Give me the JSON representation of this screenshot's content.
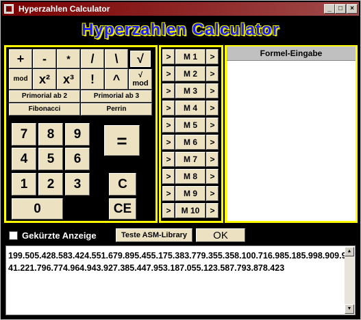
{
  "window": {
    "title": "Hyperzahlen Calculator",
    "minimize": "_",
    "maximize": "□",
    "close": "×"
  },
  "banner": {
    "title": "Hyperzahlen Calculator"
  },
  "ops": {
    "row1": [
      "+",
      "-",
      "*",
      "/",
      "\\",
      "√"
    ],
    "row2": [
      "mod",
      "x²",
      "x³",
      "!",
      "^",
      "√\nmod"
    ],
    "primorial2": "Primorial ab 2",
    "primorial3": "Primorial ab 3",
    "fibonacci": "Fibonacci",
    "perrin": "Perrin"
  },
  "keypad": {
    "keys": [
      "7",
      "8",
      "9",
      "4",
      "5",
      "6",
      "1",
      "2",
      "3",
      "0"
    ],
    "equals": "=",
    "clear": "C",
    "clear_entry": "CE"
  },
  "memory": {
    "arrow": ">",
    "labels": [
      "M 1",
      "M 2",
      "M 3",
      "M 4",
      "M 5",
      "M 6",
      "M 7",
      "M 8",
      "M 9",
      "M 10"
    ]
  },
  "formel": {
    "header": "Formel-Eingabe",
    "value": ""
  },
  "options": {
    "shortened_label": "Gekürzte Anzeige",
    "shortened_checked": false,
    "test_label": "Teste ASM-Library",
    "ok_label": "OK"
  },
  "output": {
    "text": "199.505.428.583.424.551.679.895.455.175.383.779.355.358.100.716.985.185.998.909.941.221.796.774.964.943.927.385.447.953.187.055.123.587.793.878.423"
  },
  "colors": {
    "panel_border": "#ffff00",
    "button_face": "#ece2c2",
    "title_bar": "#7a0000",
    "banner_text": "#1a1aff"
  }
}
